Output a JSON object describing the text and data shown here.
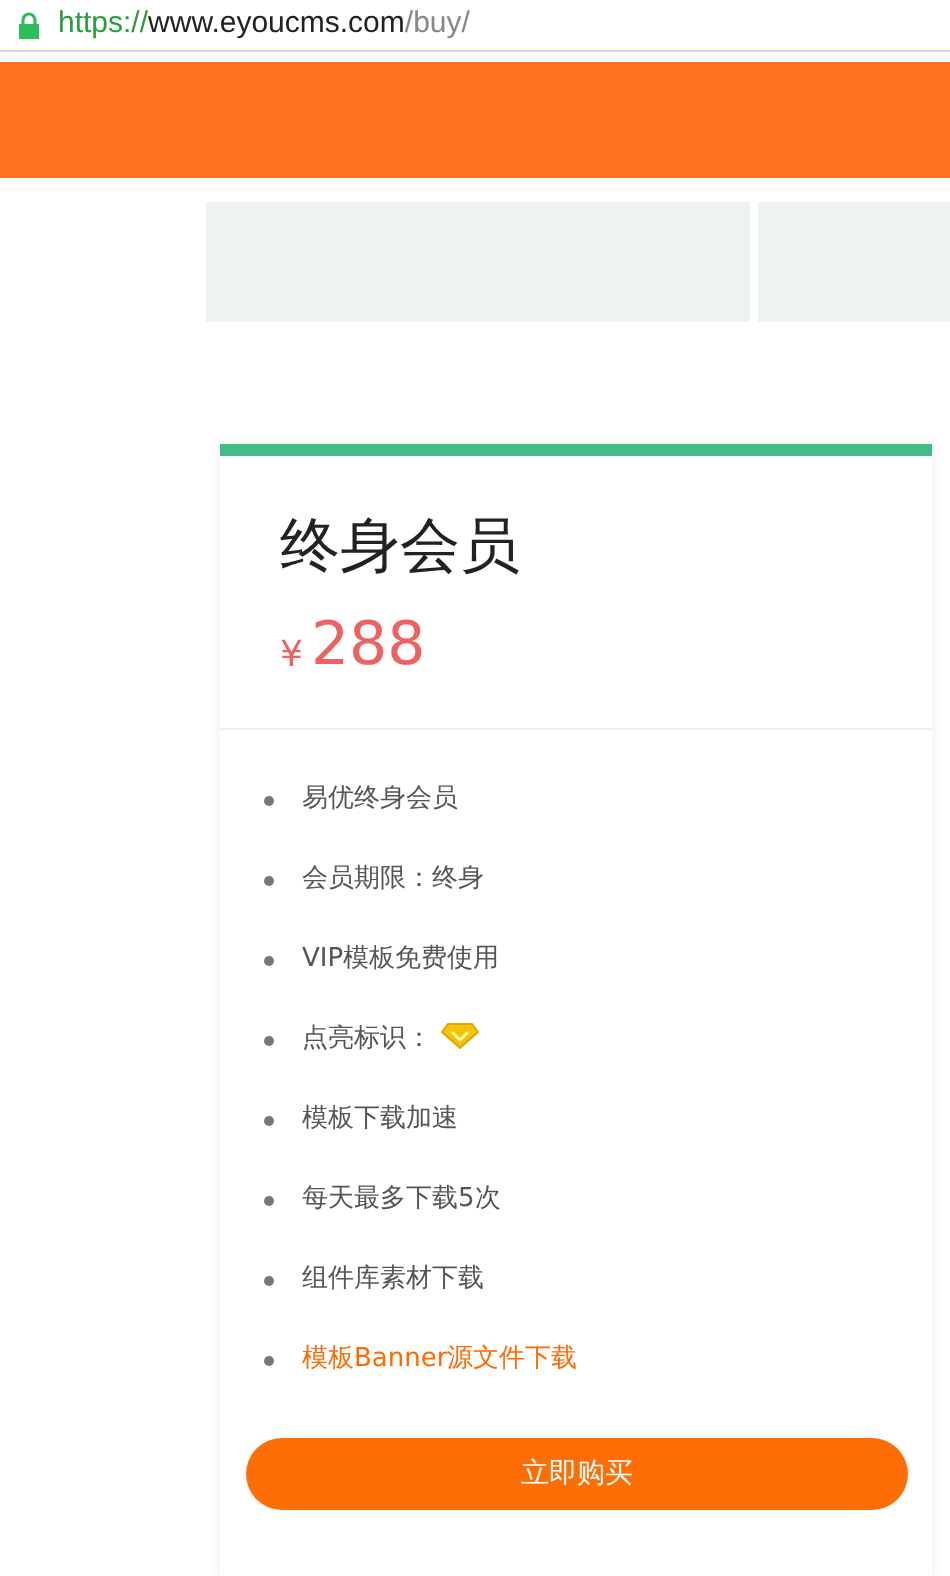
{
  "address_bar": {
    "scheme": "https://",
    "host": "www.eyoucms.com",
    "path": "/buy/"
  },
  "plan": {
    "title": "终身会员",
    "currency": "¥",
    "price": "288",
    "features": [
      {
        "kind": "text",
        "label": "易优终身会员",
        "highlighted": false
      },
      {
        "kind": "text",
        "label": "会员期限：终身",
        "highlighted": false
      },
      {
        "kind": "text",
        "label": "VIP模板免费使用",
        "highlighted": false
      },
      {
        "kind": "badge",
        "label": "点亮标识：",
        "highlighted": false
      },
      {
        "kind": "text",
        "label": "模板下载加速",
        "highlighted": false
      },
      {
        "kind": "text",
        "label": "每天最多下载5次",
        "highlighted": false
      },
      {
        "kind": "text",
        "label": "组件库素材下载",
        "highlighted": false
      },
      {
        "kind": "text",
        "label": "模板Banner源文件下载",
        "highlighted": true
      }
    ],
    "button": "立即购买"
  }
}
